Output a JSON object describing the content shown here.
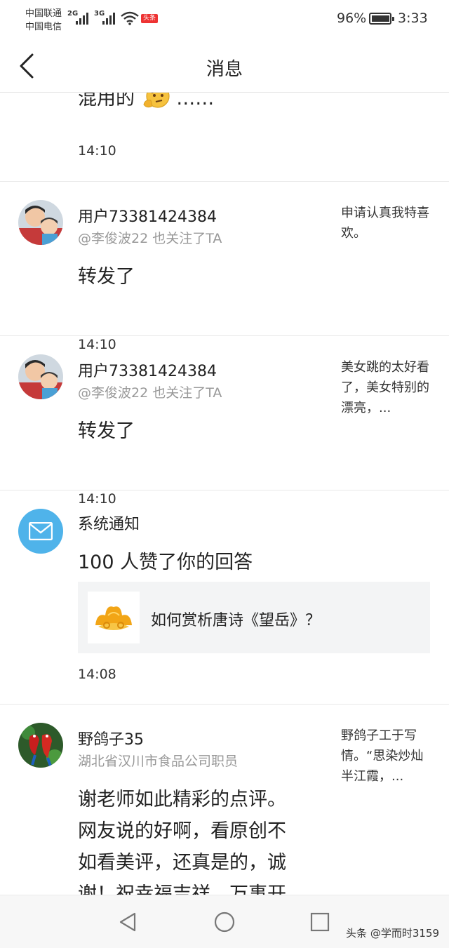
{
  "status_bar": {
    "carrier1": "中国联通",
    "carrier2": "中国电信",
    "net1": "2G",
    "net2": "3G",
    "badge": "头条",
    "battery": "96%",
    "time": "3:33"
  },
  "header": {
    "title": "消息",
    "back_icon": "chevron-left-icon"
  },
  "messages": [
    {
      "partial_text": "混用的",
      "ellipsis": "……",
      "time": "14:10"
    },
    {
      "name": "用户73381424384",
      "subline": "@李俊波22 也关注了TA",
      "text": "转发了",
      "time": "14:10",
      "quote": "申请认真我特喜欢。"
    },
    {
      "name": "用户73381424384",
      "subline": "@李俊波22 也关注了TA",
      "text": "转发了",
      "time": "14:10",
      "quote": "美女跳的太好看了，美女特别的漂亮，..."
    },
    {
      "name": "系统通知",
      "text": "100 人赞了你的回答",
      "card_title": "如何赏析唐诗《望岳》？",
      "time": "14:08",
      "icon": "mail-icon"
    },
    {
      "name": "野鸽子35",
      "subline": "湖北省汉川市食品公司职员",
      "text_lines": [
        "谢老师如此精彩的点评。",
        "网友说的好啊，看原创不",
        "如看美评，还真是的，诚",
        "谢！祝幸福吉祥，万事开"
      ],
      "quote": "野鸽子工于写情。“思染炒灿半江霞，..."
    }
  ],
  "navbar": {
    "back": "triangle-back-icon",
    "home": "circle-home-icon",
    "recents": "square-recents-icon",
    "watermark": "头条 @学而时3159"
  },
  "colors": {
    "system_icon_bg": "#4fb3ea",
    "divider": "#e8e8e8",
    "card_bg": "#f3f4f5"
  }
}
